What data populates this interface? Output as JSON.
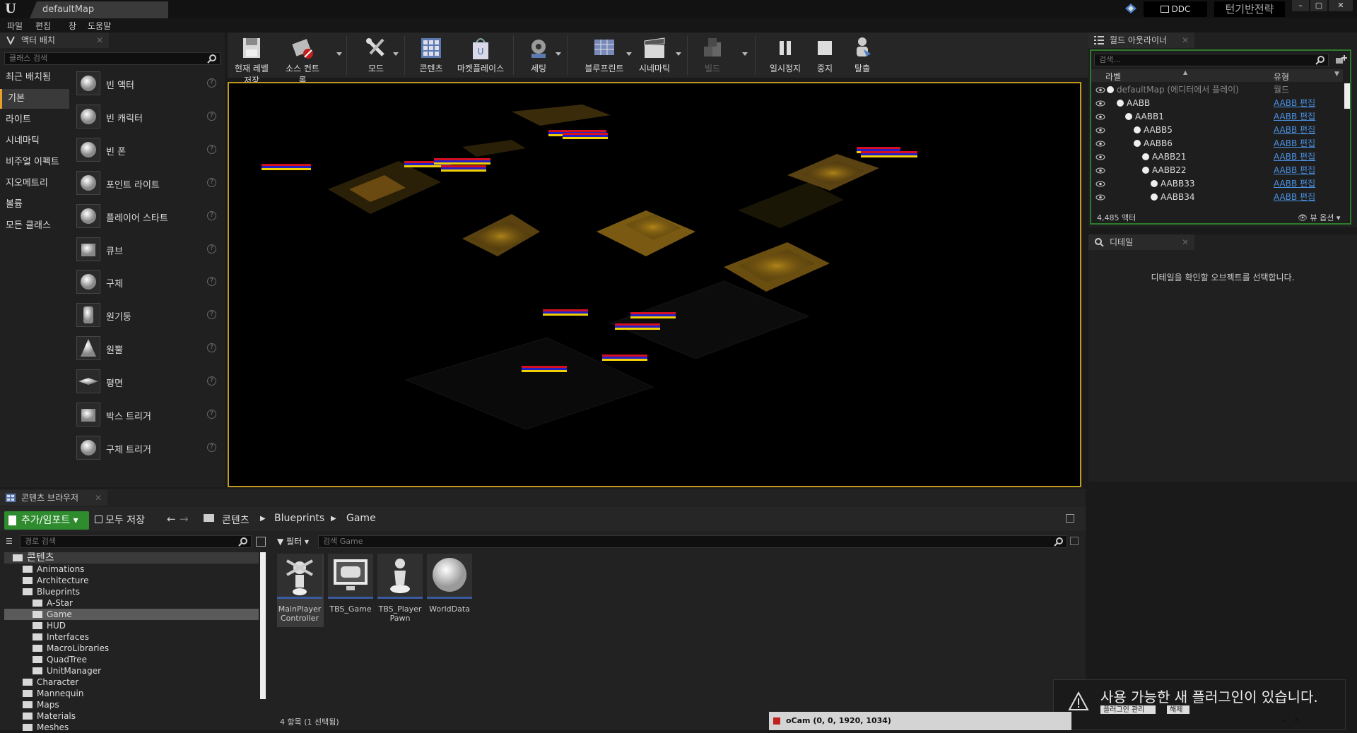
{
  "titlebar": {
    "map_name": "defaultMap",
    "ddc_label": "DDC",
    "project_name": "턴기반전략",
    "win_minimize": "–",
    "win_maximize": "▢",
    "win_close": "✕"
  },
  "menu": [
    "파일",
    "편집",
    "창",
    "도움말"
  ],
  "place_panel": {
    "tab_title": "액터 배치",
    "search_placeholder": "클래스 검색",
    "categories": [
      "최근 배치됨",
      "기본",
      "라이트",
      "시네마틱",
      "비주얼 이펙트",
      "지오메트리",
      "볼륨",
      "모든 클래스"
    ],
    "active_category": "기본",
    "items": [
      "빈 액터",
      "빈 캐릭터",
      "빈 폰",
      "포인트 라이트",
      "플레이어 스타트",
      "큐브",
      "구체",
      "원기둥",
      "원뿔",
      "평면",
      "박스 트리거",
      "구체 트리거"
    ],
    "help_glyph": "?"
  },
  "toolbar": {
    "buttons": [
      "현재 레벨 저장",
      "소스 컨트롤",
      "모드",
      "콘텐츠",
      "마켓플레이스",
      "세팅",
      "블루프린트",
      "시네마틱",
      "빌드",
      "일시정지",
      "중지",
      "탈출"
    ]
  },
  "outliner": {
    "tab_title": "월드 아웃라이너",
    "search_placeholder": "검색...",
    "col_label": "라벨",
    "col_type": "유형",
    "rows": [
      {
        "label": "defaultMap (에디터에서 플레이)",
        "type": "월드"
      },
      {
        "label": "AABB",
        "type": "AABB 편집"
      },
      {
        "label": "AABB1",
        "type": "AABB 편집"
      },
      {
        "label": "AABB5",
        "type": "AABB 편집"
      },
      {
        "label": "AABB6",
        "type": "AABB 편집"
      },
      {
        "label": "AABB21",
        "type": "AABB 편집"
      },
      {
        "label": "AABB22",
        "type": "AABB 편집"
      },
      {
        "label": "AABB33",
        "type": "AABB 편집"
      },
      {
        "label": "AABB34",
        "type": "AABB 편집"
      }
    ],
    "actor_count": "4,485 액터",
    "view_options": "뷰 옵션"
  },
  "details": {
    "tab_title": "디테일",
    "empty_message": "디테일을 확인할 오브젝트를 선택합니다."
  },
  "content_browser": {
    "tab_title": "콘텐츠 브라우저",
    "add_import": "추가/임포트",
    "save_all": "모두 저장",
    "breadcrumb": [
      "콘텐츠",
      "Blueprints",
      "Game"
    ],
    "path_search_placeholder": "경로 검색",
    "filter_label": "필터",
    "asset_search_placeholder": "검색 Game",
    "tree": [
      {
        "label": "콘텐츠",
        "depth": 0
      },
      {
        "label": "Animations",
        "depth": 1
      },
      {
        "label": "Architecture",
        "depth": 1
      },
      {
        "label": "Blueprints",
        "depth": 1
      },
      {
        "label": "A-Star",
        "depth": 2
      },
      {
        "label": "Game",
        "depth": 2
      },
      {
        "label": "HUD",
        "depth": 2
      },
      {
        "label": "Interfaces",
        "depth": 2
      },
      {
        "label": "MacroLibraries",
        "depth": 2
      },
      {
        "label": "QuadTree",
        "depth": 2
      },
      {
        "label": "UnitManager",
        "depth": 2
      },
      {
        "label": "Character",
        "depth": 1
      },
      {
        "label": "Mannequin",
        "depth": 1
      },
      {
        "label": "Maps",
        "depth": 1
      },
      {
        "label": "Materials",
        "depth": 1
      },
      {
        "label": "Meshes",
        "depth": 1
      }
    ],
    "assets": [
      {
        "line1": "MainPlayer",
        "line2": "Controller"
      },
      {
        "line1": "TBS_Game",
        "line2": ""
      },
      {
        "line1": "TBS_Player",
        "line2": "Pawn"
      },
      {
        "line1": "WorldData",
        "line2": ""
      }
    ],
    "status": "4 항목 (1 선택됨)"
  },
  "notification": {
    "message": "사용 가능한 새 플러그인이 있습니다.",
    "manage_button": "플러그인 관리",
    "dismiss_button": "해제"
  },
  "ocam": {
    "title": "oCam (0, 0, 1920, 1034)",
    "minimize": "–",
    "close": "✕"
  },
  "colors": {
    "accent": "#e8a22a",
    "add_button": "#2e8b2e",
    "link": "#4a90e2",
    "viewport_border": "#c49a1e",
    "marker_red": "#d41020",
    "marker_blue": "#2420c8",
    "marker_yellow": "#f0d000"
  }
}
